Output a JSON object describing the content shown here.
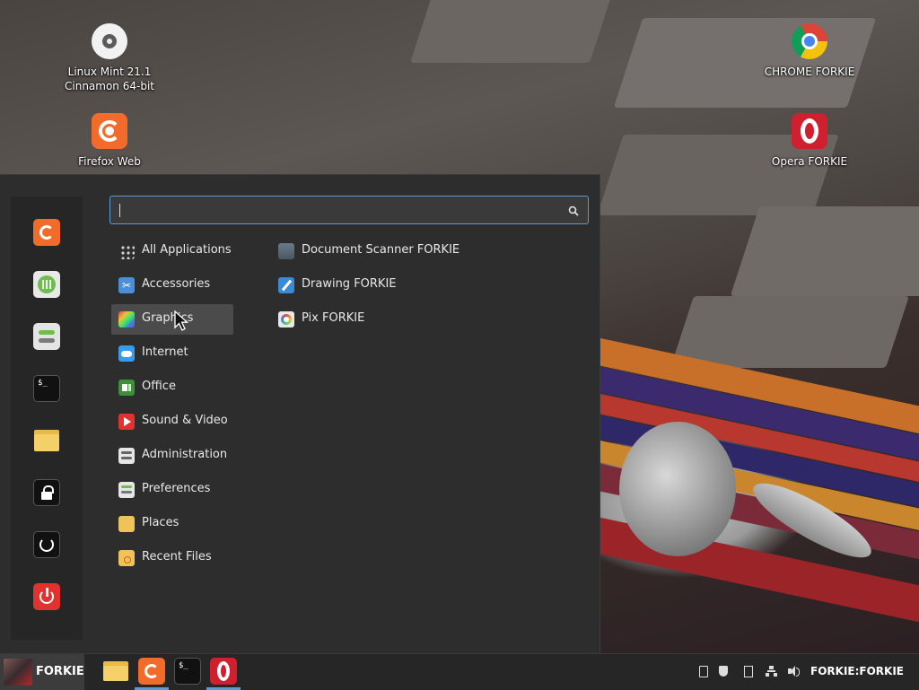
{
  "desktop": {
    "icons": [
      {
        "label_1": "Linux Mint 21.1",
        "label_2": "Cinnamon 64-bit",
        "icon": "disc-icon"
      },
      {
        "label_1": "Firefox Web",
        "label_2": "",
        "icon": "firefox-icon"
      },
      {
        "label_1": "CHROME FORKIE",
        "icon": "chrome-icon"
      },
      {
        "label_1": "Opera FORKIE",
        "icon": "opera-icon"
      }
    ]
  },
  "menu": {
    "search": {
      "value": "",
      "placeholder": ""
    },
    "sidebar": [
      {
        "icon": "firefox-icon"
      },
      {
        "icon": "software-manager-icon"
      },
      {
        "icon": "system-settings-icon"
      },
      {
        "icon": "terminal-icon"
      },
      {
        "icon": "files-icon"
      },
      {
        "icon": "lock-icon"
      },
      {
        "icon": "logout-icon"
      },
      {
        "icon": "power-icon"
      }
    ],
    "categories": [
      {
        "label": "All Applications"
      },
      {
        "label": "Accessories"
      },
      {
        "label": "Graphics"
      },
      {
        "label": "Internet"
      },
      {
        "label": "Office"
      },
      {
        "label": "Sound & Video"
      },
      {
        "label": "Administration"
      },
      {
        "label": "Preferences"
      },
      {
        "label": "Places"
      },
      {
        "label": "Recent Files"
      }
    ],
    "apps": [
      {
        "label": "Document Scanner FORKIE"
      },
      {
        "label": "Drawing FORKIE"
      },
      {
        "label": "Pix FORKIE"
      }
    ]
  },
  "taskbar": {
    "menu_label": "FORKIE",
    "user_label": "FORKIE:FORKIE"
  },
  "colors": {
    "accent": "#5a9bd4",
    "menu_bg": "#2d2d2d",
    "active_item": "#4b4b4b"
  }
}
